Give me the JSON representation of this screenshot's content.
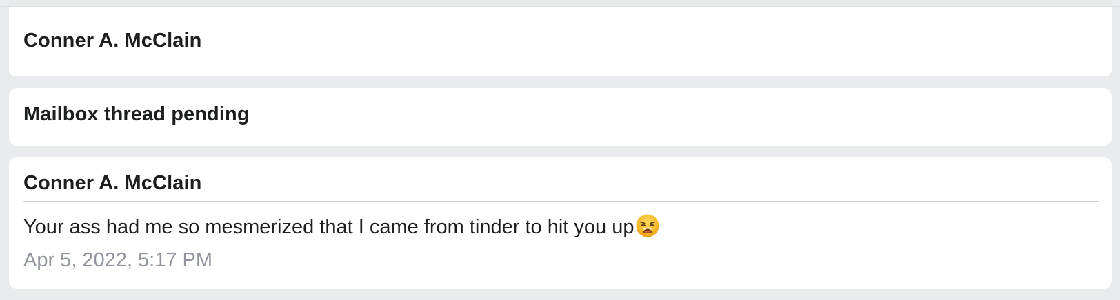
{
  "cards": [
    {
      "title": "Conner A. McClain"
    },
    {
      "title": "Mailbox thread pending"
    },
    {
      "title": "Conner A. McClain",
      "message": "Your ass had me so mesmerized that I came from tinder to hit you up",
      "emoji": "weary-face-icon",
      "timestamp": "Apr 5, 2022, 5:17 PM"
    }
  ],
  "colors": {
    "background": "#e9ebee",
    "card": "#ffffff",
    "text": "#1c1e21",
    "timestamp": "#90949c",
    "divider": "#c9ccd1"
  }
}
